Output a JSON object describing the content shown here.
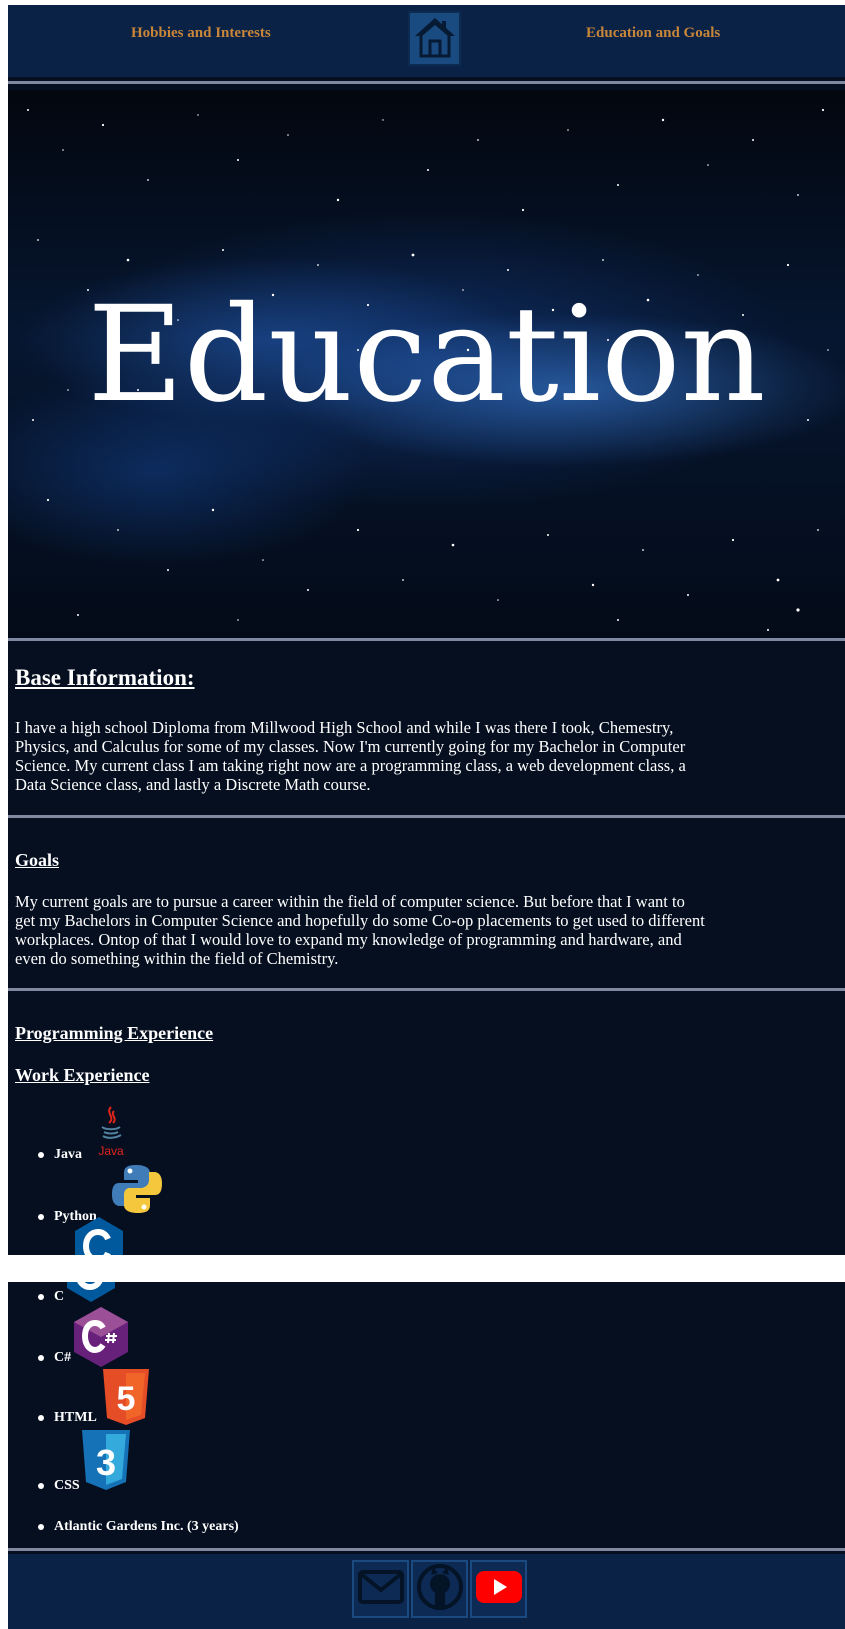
{
  "nav": {
    "hobbies_label": "Hobbies and Interests",
    "education_label": "Education and Goals",
    "home_icon": "home-icon"
  },
  "hero": {
    "title": "Education"
  },
  "base_information": {
    "heading": "Base Information:",
    "lines": [
      "I have a high school Diploma from Millwood High School and while I was there I took, Chemestry,",
      "Physics, and Calculus for some of my classes. Now I'm currently going for my Bachelor in Computer",
      "Science. My current class I am taking right now are a programming class, a web development class, a",
      "Data Science class, and lastly a Discrete Math course."
    ]
  },
  "goals": {
    "heading": "Goals",
    "lines": [
      "My current goals are to pursue a career within the field of computer science. But before that I want to",
      "get my Bachelors in Computer Science and hopefully do some Co-op placements to get used to different",
      "workplaces. Ontop of that I would love to expand my knowledge of programming and hardware, and",
      "even do something within the field of Chemistry."
    ]
  },
  "programming_experience": {
    "heading": "Programming Experience",
    "languages": [
      {
        "label": "Java",
        "icon": "java-logo-icon",
        "logo_text": "Java"
      },
      {
        "label": "Python",
        "icon": "python-logo-icon"
      },
      {
        "label": "C",
        "icon": "c-logo-icon"
      },
      {
        "label": "C#",
        "icon": "csharp-logo-icon"
      },
      {
        "label": "HTML",
        "icon": "html5-logo-icon",
        "logo_text": "5"
      },
      {
        "label": "CSS",
        "icon": "css3-logo-icon",
        "logo_text": "3"
      }
    ]
  },
  "work_experience": {
    "heading": "Work Experience",
    "items": [
      {
        "label": "Atlantic Gardens Inc. (3 years)"
      }
    ]
  },
  "footer": {
    "icons": [
      "mail-icon",
      "github-icon",
      "youtube-icon"
    ]
  },
  "colors": {
    "background": "#050f20",
    "nav_background": "#0a2245",
    "nav_link": "#c8863a",
    "divider": "#7f8aa0",
    "text": "#ffffff"
  }
}
